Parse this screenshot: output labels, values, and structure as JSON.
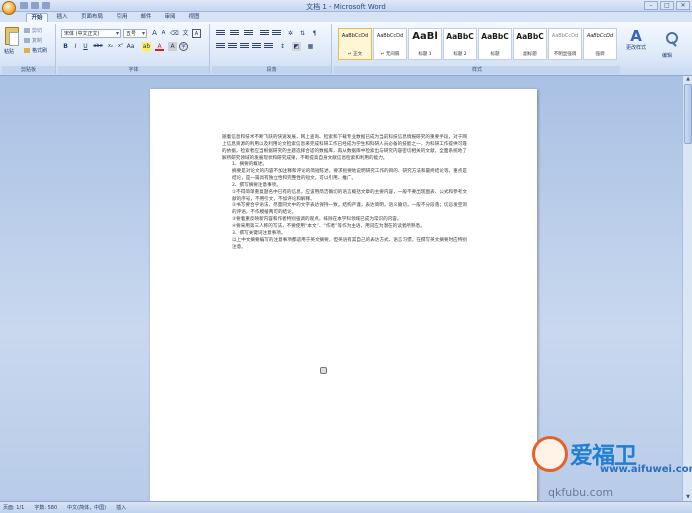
{
  "window": {
    "title": "文档 1 - Microsoft Word"
  },
  "tabs": [
    "开始",
    "插入",
    "页面布局",
    "引用",
    "邮件",
    "审阅",
    "视图"
  ],
  "clipboard": {
    "paste": "粘贴",
    "cut": "剪切",
    "copy": "复制",
    "format_painter": "格式刷",
    "label": "剪贴板"
  },
  "font": {
    "name": "宋体 (中文正文)",
    "size": "五号",
    "bold": "B",
    "italic": "I",
    "underline": "U",
    "strike": "abe",
    "grow": "A",
    "shrink": "A",
    "label": "字体"
  },
  "paragraph": {
    "label": "段落"
  },
  "styles": {
    "label": "样式",
    "items": [
      {
        "sample": "AaBbCcDd",
        "name": "↵ 正文"
      },
      {
        "sample": "AaBbCcDd",
        "name": "↵ 无间隔"
      },
      {
        "sample": "AaBl",
        "name": "标题 1"
      },
      {
        "sample": "AaBbC",
        "name": "标题 2"
      },
      {
        "sample": "AaBbC",
        "name": "标题"
      },
      {
        "sample": "AaBbC",
        "name": "副标题"
      },
      {
        "sample": "AaBbCcDd",
        "name": "不明显强调"
      },
      {
        "sample": "AaBbCcDd",
        "name": "强调"
      }
    ],
    "change_styles": "更改样式"
  },
  "editing": {
    "label": "编辑"
  },
  "document": {
    "paragraphs": [
      {
        "text": "随着信息和技术不断飞跃的快速发展，网上查询、检索和下载专业数据已成为当前科技信息情报研究的重要手段，对于网上信息资源的利用以及利用论文检索信息来完成科研工作已经成为学生和科研人员必备的技能之一，为科研工作提供可靠的依据，检索者应当根据研究的主题选择合适的数据库，再从数据库中检索出与研究内容密切相关的文献，全面系统地了解所研究领域的发展现状和研究成果，不断提高自身文献信息检索和利用的能力。",
        "cls": ""
      },
      {
        "text": "1、摘要的概述。",
        "cls": "h"
      },
      {
        "text": "摘要是对论文的内容不加注释和评论的简短陈述，要求扼要地说明研究工作的目的、研究方法和最终结论等，重点是结论，是一篇具有独立性和完整性的短文，可以引用、推广。",
        "cls": "h"
      },
      {
        "text": "2、撰写摘要注意事项。",
        "cls": "h"
      },
      {
        "text": "①不得简单重复题名中已有的信息，应该用简洁确切的语言概括文章的主要内容，一般不要出现图表、公式和参考文献的序号，不用引文，不加评论和解释。",
        "cls": "h"
      },
      {
        "text": "②书写要合乎语法，尽量同文中的文字表达保持一致，结构严谨，表达简明，语义确切，一般不分段落；切忌发空洞的评语，不作模棱两可的结论。",
        "cls": "h"
      },
      {
        "text": "③要着重反映新内容和作者特别强调的观点，排除在本学科领域已成为常识的内容。",
        "cls": "h"
      },
      {
        "text": "④要采用第三人称的写法，不要使用“本文”、“作者”等作为主语，用词应为潜在的读者所熟悉。",
        "cls": "h"
      },
      {
        "text": "3、撰写关键词注意事项。",
        "cls": "h"
      },
      {
        "text": "以上中文摘要编写的注意事项都适用于英文摘要，但英语有其自己的表达方式、语言习惯，在撰写英文摘要时应特别注意。",
        "cls": "h"
      }
    ]
  },
  "status": {
    "page": "页面: 1/1",
    "words": "字数: 580",
    "lang": "中文(简体，中国)",
    "mode": "插入"
  },
  "watermark": {
    "brand": "爱福卫",
    "url": "www.aifuwei.com",
    "url2": "qkfubu.com"
  }
}
